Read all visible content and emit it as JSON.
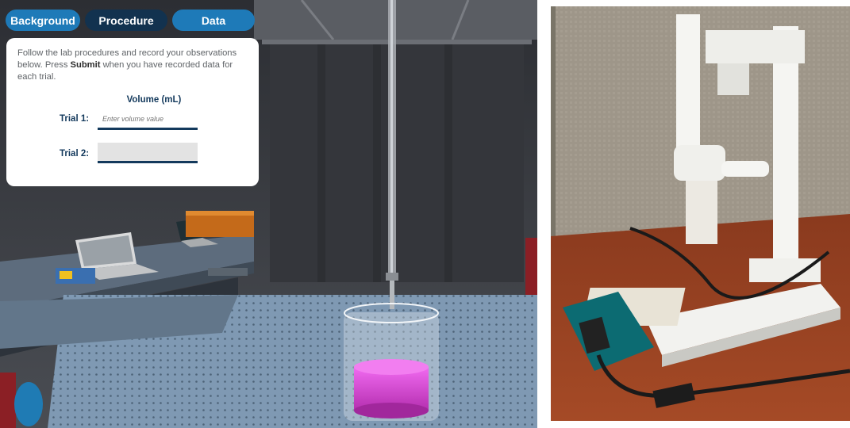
{
  "tabs": {
    "background": "Background",
    "procedure": "Procedure",
    "data": "Data"
  },
  "panel": {
    "instruction_part1": "Follow the lab procedures and record your observations below. Press ",
    "instruction_bold": "Submit",
    "instruction_part2": " when you have recorded data for each trial.",
    "column_header": "Volume (mL)",
    "trial1_label": "Trial 1:",
    "trial1_placeholder": "Enter volume value",
    "trial2_label": "Trial 2:"
  },
  "colors": {
    "tab_active": "#12324f",
    "tab_inactive": "#1e7ab8",
    "solution": "#d43fd0"
  },
  "icons": {
    "burette": "burette-icon",
    "beaker": "beaker-icon",
    "laptop": "laptop-icon"
  }
}
